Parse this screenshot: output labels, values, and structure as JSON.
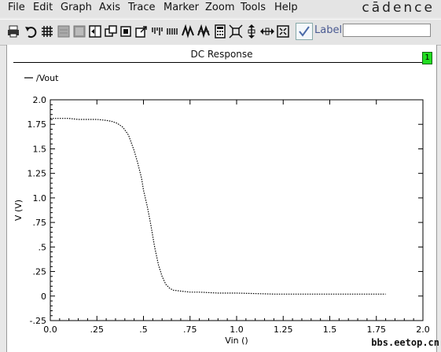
{
  "menubar": {
    "items": [
      "File",
      "Edit",
      "Graph",
      "Axis",
      "Trace",
      "Marker",
      "Zoom",
      "Tools",
      "Help"
    ],
    "logo": "cādence"
  },
  "toolbar": {
    "icons": [
      "print-icon",
      "undo-icon",
      "grid-icon",
      "strip-icon",
      "strip2-icon",
      "split-icon",
      "copy-icon",
      "copy2-icon",
      "copy3-icon",
      "bars-icon",
      "bars2-icon",
      "waveform-icon",
      "waveform2-icon",
      "calculator-icon",
      "zoom-fit-icon",
      "zoom-y-icon",
      "zoom-x-icon",
      "zoom-in-icon"
    ],
    "label_text": "Label",
    "label_input_value": ""
  },
  "subwindow": {
    "title": "DC Response",
    "number": "1"
  },
  "chart_data": {
    "type": "line",
    "title": "",
    "xlabel": "Vin ()",
    "ylabel": "V (V)",
    "xlim": [
      0.0,
      2.0
    ],
    "ylim": [
      -0.25,
      2.0
    ],
    "x_ticks": [
      "0.0",
      ".25",
      ".5",
      ".75",
      "1.0",
      "1.25",
      "1.5",
      "1.75",
      "2.0"
    ],
    "y_ticks": [
      "-.25",
      "0",
      ".25",
      ".5",
      ".75",
      "1.0",
      "1.25",
      "1.5",
      "1.75",
      "2.0"
    ],
    "legend": "top-left",
    "series": [
      {
        "name": "/Vout",
        "style": "dotted",
        "x": [
          0.0,
          0.1,
          0.15,
          0.2,
          0.25,
          0.3,
          0.33,
          0.36,
          0.39,
          0.42,
          0.45,
          0.47,
          0.49,
          0.5,
          0.52,
          0.54,
          0.56,
          0.58,
          0.6,
          0.62,
          0.64,
          0.66,
          0.7,
          0.75,
          0.8,
          0.9,
          1.0,
          1.2,
          1.4,
          1.6,
          1.8
        ],
        "y": [
          1.81,
          1.81,
          1.8,
          1.8,
          1.8,
          1.79,
          1.78,
          1.76,
          1.72,
          1.64,
          1.48,
          1.35,
          1.2,
          1.08,
          0.92,
          0.72,
          0.5,
          0.32,
          0.2,
          0.12,
          0.08,
          0.06,
          0.05,
          0.04,
          0.04,
          0.03,
          0.03,
          0.02,
          0.02,
          0.02,
          0.02
        ]
      }
    ]
  },
  "watermark": "bbs.eetop.cn"
}
